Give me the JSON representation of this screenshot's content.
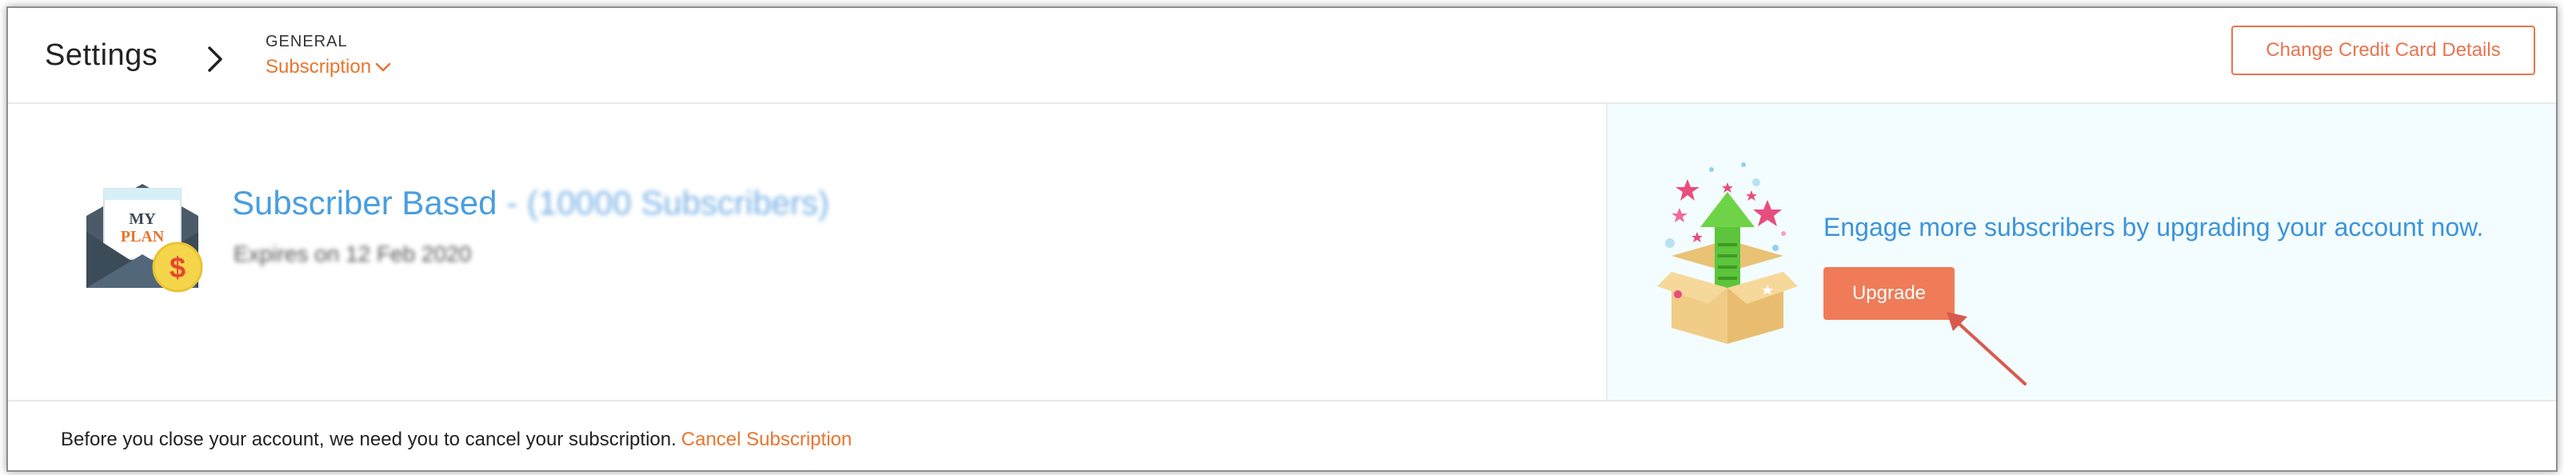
{
  "header": {
    "title": "Settings",
    "breadcrumb": {
      "section": "GENERAL",
      "current": "Subscription"
    },
    "change_cc_label": "Change Credit Card Details"
  },
  "plan": {
    "icon_text_line1": "MY",
    "icon_text_line2": "PLAN",
    "icon_symbol": "$",
    "name": "Subscriber Based",
    "separator": " - ",
    "subscribers": "(10000 Subscribers)",
    "expiry": "Expires on 12 Feb 2020"
  },
  "upgrade": {
    "message": "Engage more subscribers by upgrading your account now.",
    "button_label": "Upgrade"
  },
  "footer": {
    "message": "Before you close your account, we need you to cancel your subscription.",
    "cancel_label": "Cancel Subscription"
  },
  "icons": {
    "breadcrumb_separator": "chevron-right-icon",
    "dropdown": "chevron-down-icon",
    "plan": "plan-envelope-icon",
    "upgrade": "gift-box-arrow-icon",
    "annotation": "pointer-arrow-icon"
  },
  "colors": {
    "accent_orange": "#e8752f",
    "button_orange": "#ef7b58",
    "link_blue": "#4a9ee0",
    "panel_bg": "#f3fcfe"
  }
}
